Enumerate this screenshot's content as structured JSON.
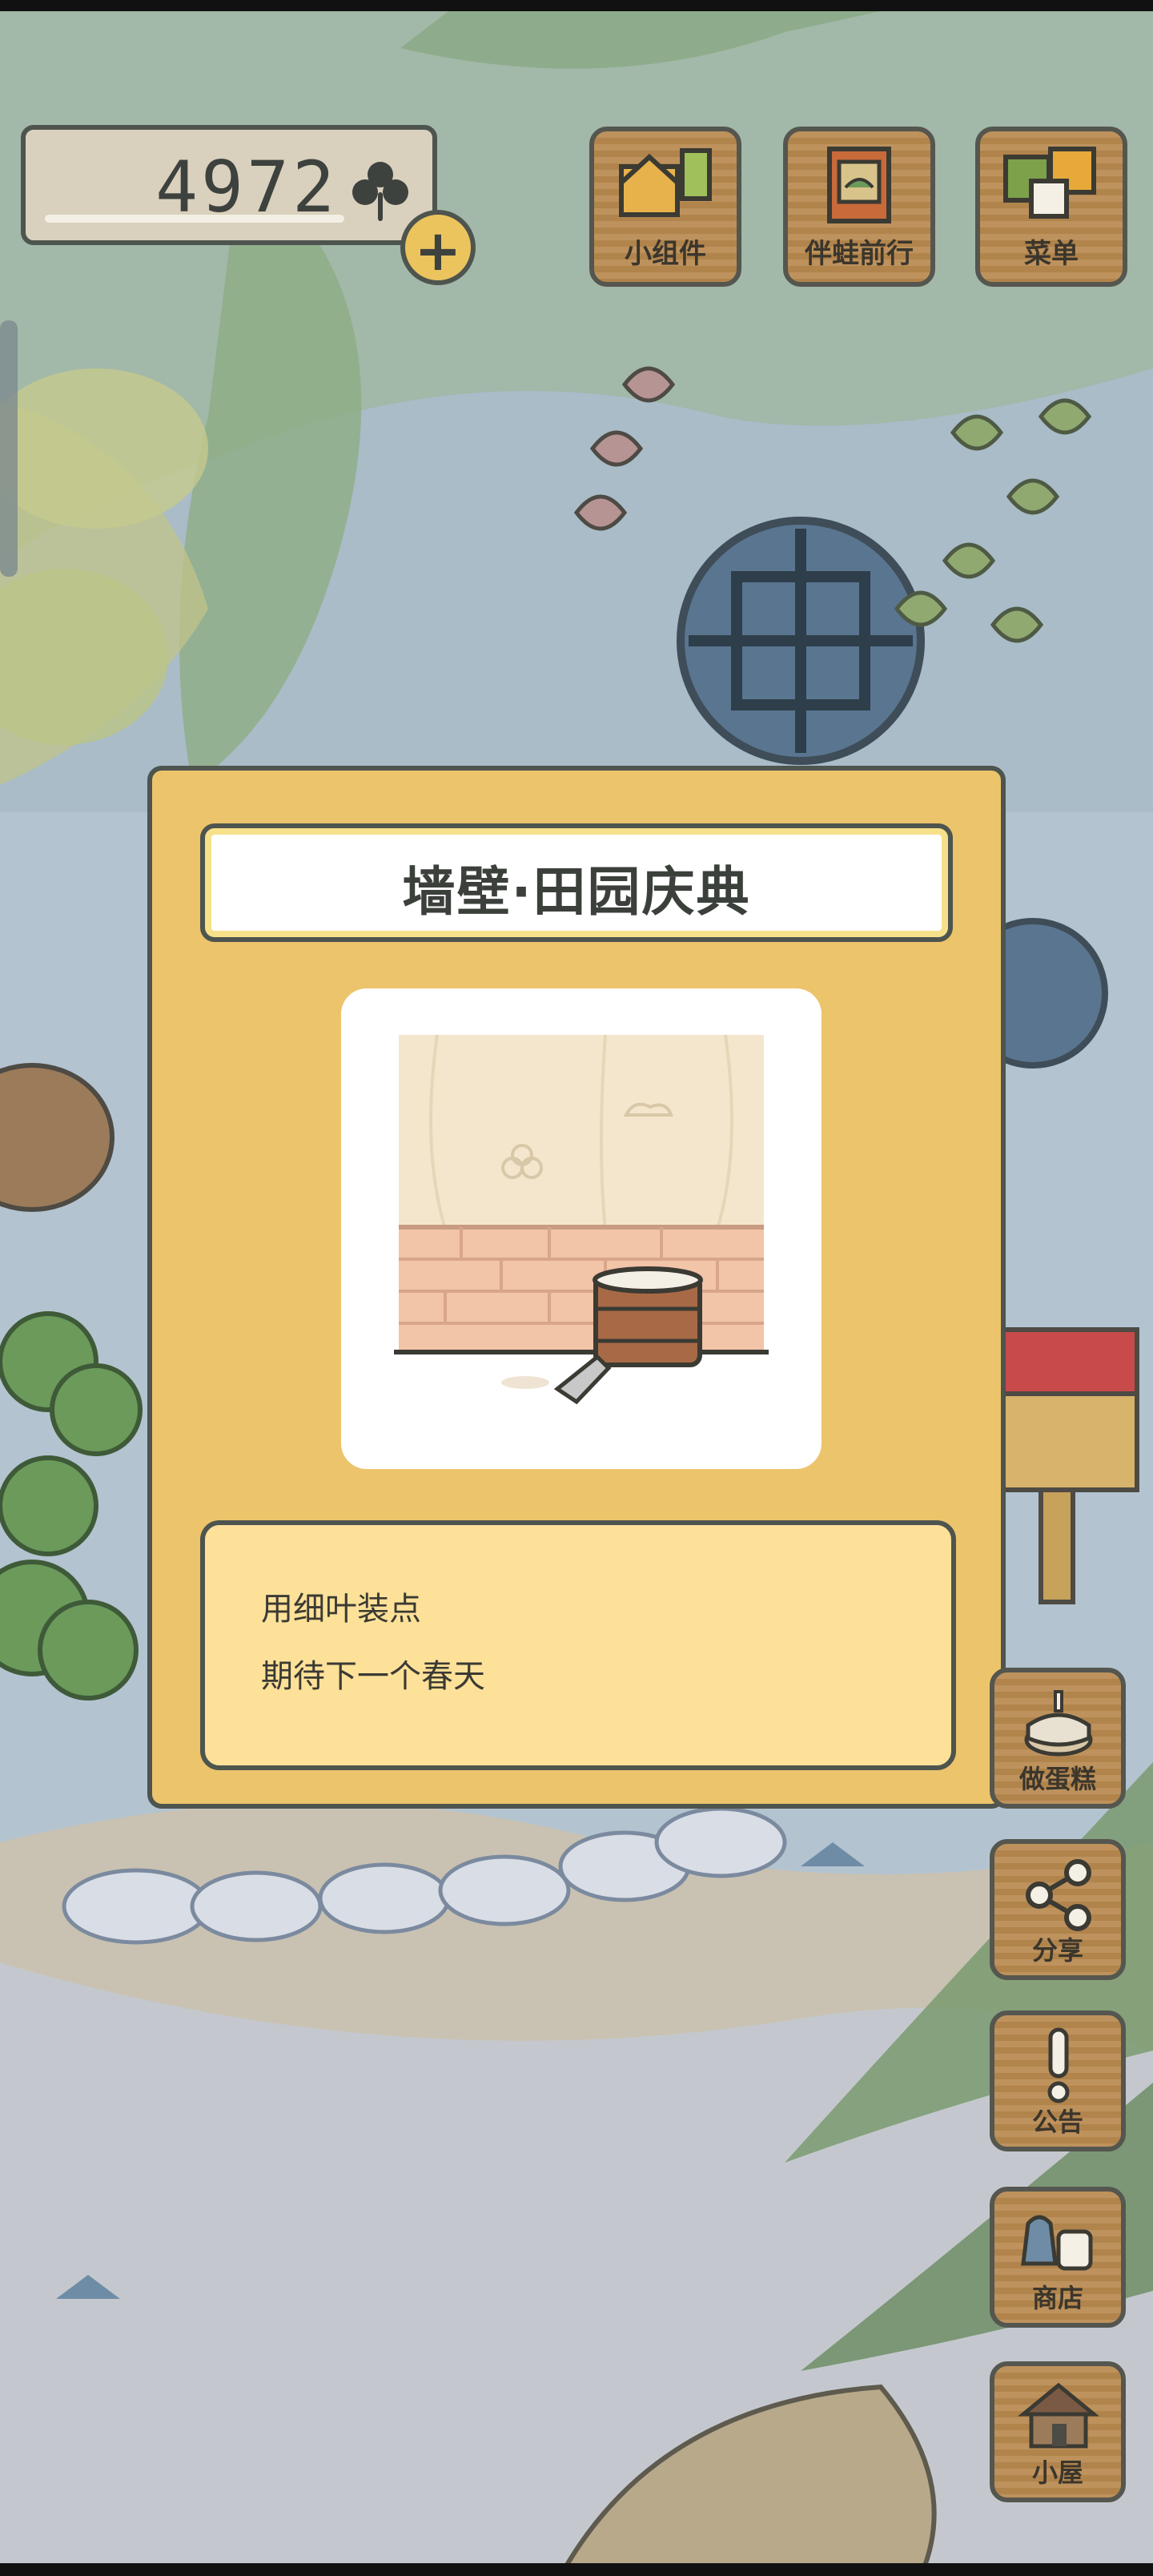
{
  "currency": {
    "amount": "4972",
    "icon": "clover-icon",
    "add_icon": "plus-icon"
  },
  "top_buttons": [
    {
      "label": "小组件",
      "icon": "widget-icon"
    },
    {
      "label": "伴蛙前行",
      "icon": "journey-icon"
    },
    {
      "label": "菜单",
      "icon": "menu-icon"
    }
  ],
  "item_dialog": {
    "title": "墙壁·田园庆典",
    "image": "wall-with-paint-bucket",
    "description": [
      "用细叶装点",
      "期待下一个春天"
    ]
  },
  "side_buttons": [
    {
      "label": "做蛋糕",
      "icon": "cake-icon"
    },
    {
      "label": "分享",
      "icon": "share-icon"
    },
    {
      "label": "公告",
      "icon": "notice-icon"
    },
    {
      "label": "商店",
      "icon": "shop-icon"
    },
    {
      "label": "小屋",
      "icon": "house-icon"
    }
  ],
  "colors": {
    "dialog_bg": "#ecc46c",
    "desc_bg": "#fde199",
    "outline": "#4e544e",
    "wood": "#b8894f"
  }
}
